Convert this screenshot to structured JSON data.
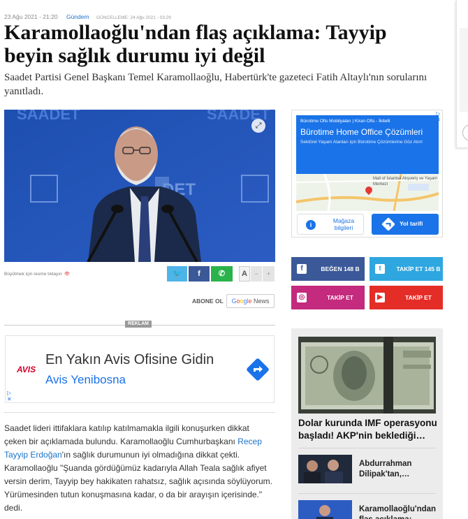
{
  "article": {
    "date": "23 Ağu 2021 - 21:20",
    "category": "Gündem",
    "updated": "GÜNCELLEME: 24 Ağu 2021 - 03:29",
    "headline": "Karamollaoğlu'ndan flaş açıklama: Tayyip beyin sağlık durumu iyi değil",
    "spot": "Saadet Partisi Genel Başkanı Temel Karamollaoğlu, Habertürk'te gazeteci Fatih Altaylı'nın sorularını yanıtladı.",
    "photo_backdrop_text_left": "SAADET",
    "photo_backdrop_text_mid": "DET",
    "enlarge_caption": "Büyütmek için resme tıklayın",
    "share": {
      "twitter_icon": "twitter-icon",
      "facebook_icon": "facebook-icon",
      "whatsapp_icon": "whatsapp-icon"
    },
    "font_controls": {
      "a": "A",
      "minus": "−",
      "plus": "+"
    },
    "subscribe_label": "ABONE OL",
    "gnews": {
      "g": "G",
      "o1": "o",
      "o2": "o",
      "g2": "g",
      "l": "l",
      "e": "e",
      "news": " News"
    },
    "ad_label": "REKLAM",
    "body": {
      "p1_a": "Saadet lideri ittifaklara katılıp katılmamakla ilgili konuşurken dikkat çeken bir açıklamada bulundu. Karamollaoğlu Cumhurbaşkanı ",
      "p1_link": "Recep Tayyip Erdoğan",
      "p1_b": "'ın sağlık durumunun iyi olmadığına dikkat çekti.",
      "p2": "Karamollaoğlu \"Şuanda gördüğümüz kadarıyla Allah Teala sağlık afiyet versin derim, Tayyip bey hakikaten rahatsız, sağlık açısında söylüyorum. Yürümesinden tutun konuşmasına kadar, o da bir arayışın içerisinde.\" dedi."
    }
  },
  "avis_ad": {
    "logo": "AVIS",
    "title": "En Yakın Avis Ofisine Gidin",
    "subtitle": "Avis Yenibosna",
    "x": "✕"
  },
  "map_ad": {
    "small": "Bürotime Ofis Mobilyaları | Kiran Ofis - İkitelli",
    "title": "Bürotime Home Office Çözümleri",
    "desc": "Sektörel Yaşam Alanları için Bürotime Çözümlerine Göz Atın!",
    "map_label": "Mall of İstanbul Alışveriş ve Yaşam Merkezi",
    "store_btn": "Mağaza bilgileri",
    "route_btn": "Yol tarifi",
    "corner": "✕"
  },
  "social": {
    "facebook": "BEĞEN 148 B",
    "twitter": "TAKİP ET 145 B",
    "instagram": "TAKİP ET",
    "youtube": "TAKİP ET",
    "fb_glyph": "f",
    "tw_glyph": "t",
    "ig_glyph": "◎",
    "yt_glyph": "▶"
  },
  "sidebar_news": {
    "main_title": "Dolar kurunda IMF operasyonu başladı! AKP'nin beklediği…",
    "item1": "Abdurrahman Dilipak'tan,…",
    "item2": "Karamollaoğlu'ndan flaş açıklama: Tayy…"
  },
  "colors": {
    "accent_blue": "#1a73c9",
    "facebook": "#3b5998",
    "twitter": "#2ea7e0",
    "instagram": "#c42a7d",
    "youtube": "#e52d27",
    "avis_red": "#d4002a"
  }
}
